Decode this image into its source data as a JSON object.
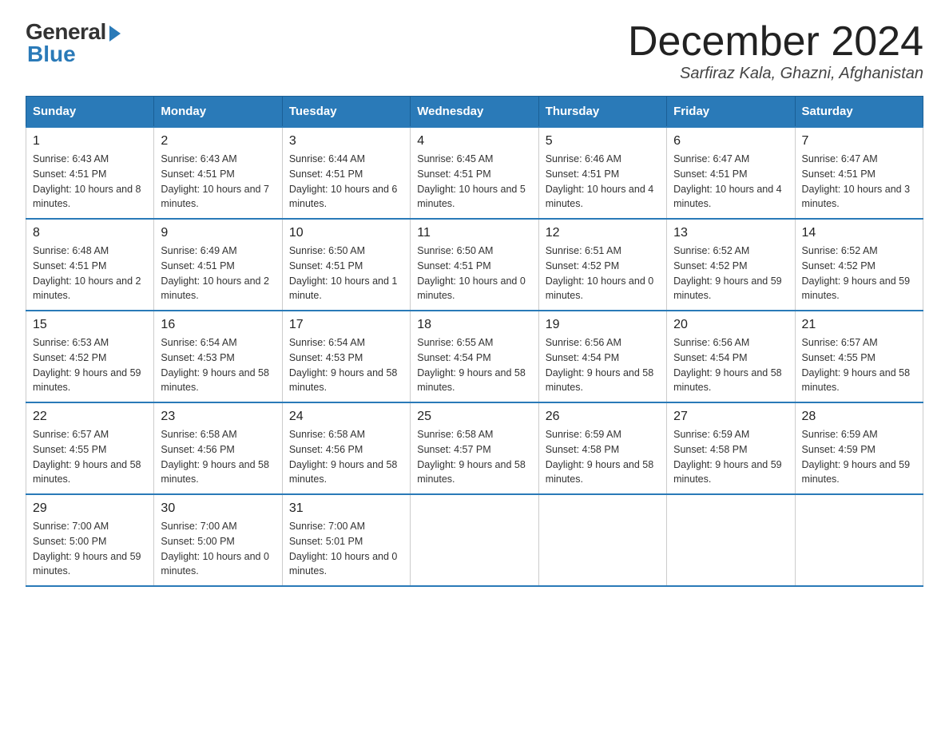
{
  "logo": {
    "general": "General",
    "blue": "Blue"
  },
  "header": {
    "month": "December 2024",
    "location": "Sarfiraz Kala, Ghazni, Afghanistan"
  },
  "weekdays": [
    "Sunday",
    "Monday",
    "Tuesday",
    "Wednesday",
    "Thursday",
    "Friday",
    "Saturday"
  ],
  "weeks": [
    [
      {
        "day": "1",
        "sunrise": "6:43 AM",
        "sunset": "4:51 PM",
        "daylight": "10 hours and 8 minutes."
      },
      {
        "day": "2",
        "sunrise": "6:43 AM",
        "sunset": "4:51 PM",
        "daylight": "10 hours and 7 minutes."
      },
      {
        "day": "3",
        "sunrise": "6:44 AM",
        "sunset": "4:51 PM",
        "daylight": "10 hours and 6 minutes."
      },
      {
        "day": "4",
        "sunrise": "6:45 AM",
        "sunset": "4:51 PM",
        "daylight": "10 hours and 5 minutes."
      },
      {
        "day": "5",
        "sunrise": "6:46 AM",
        "sunset": "4:51 PM",
        "daylight": "10 hours and 4 minutes."
      },
      {
        "day": "6",
        "sunrise": "6:47 AM",
        "sunset": "4:51 PM",
        "daylight": "10 hours and 4 minutes."
      },
      {
        "day": "7",
        "sunrise": "6:47 AM",
        "sunset": "4:51 PM",
        "daylight": "10 hours and 3 minutes."
      }
    ],
    [
      {
        "day": "8",
        "sunrise": "6:48 AM",
        "sunset": "4:51 PM",
        "daylight": "10 hours and 2 minutes."
      },
      {
        "day": "9",
        "sunrise": "6:49 AM",
        "sunset": "4:51 PM",
        "daylight": "10 hours and 2 minutes."
      },
      {
        "day": "10",
        "sunrise": "6:50 AM",
        "sunset": "4:51 PM",
        "daylight": "10 hours and 1 minute."
      },
      {
        "day": "11",
        "sunrise": "6:50 AM",
        "sunset": "4:51 PM",
        "daylight": "10 hours and 0 minutes."
      },
      {
        "day": "12",
        "sunrise": "6:51 AM",
        "sunset": "4:52 PM",
        "daylight": "10 hours and 0 minutes."
      },
      {
        "day": "13",
        "sunrise": "6:52 AM",
        "sunset": "4:52 PM",
        "daylight": "9 hours and 59 minutes."
      },
      {
        "day": "14",
        "sunrise": "6:52 AM",
        "sunset": "4:52 PM",
        "daylight": "9 hours and 59 minutes."
      }
    ],
    [
      {
        "day": "15",
        "sunrise": "6:53 AM",
        "sunset": "4:52 PM",
        "daylight": "9 hours and 59 minutes."
      },
      {
        "day": "16",
        "sunrise": "6:54 AM",
        "sunset": "4:53 PM",
        "daylight": "9 hours and 58 minutes."
      },
      {
        "day": "17",
        "sunrise": "6:54 AM",
        "sunset": "4:53 PM",
        "daylight": "9 hours and 58 minutes."
      },
      {
        "day": "18",
        "sunrise": "6:55 AM",
        "sunset": "4:54 PM",
        "daylight": "9 hours and 58 minutes."
      },
      {
        "day": "19",
        "sunrise": "6:56 AM",
        "sunset": "4:54 PM",
        "daylight": "9 hours and 58 minutes."
      },
      {
        "day": "20",
        "sunrise": "6:56 AM",
        "sunset": "4:54 PM",
        "daylight": "9 hours and 58 minutes."
      },
      {
        "day": "21",
        "sunrise": "6:57 AM",
        "sunset": "4:55 PM",
        "daylight": "9 hours and 58 minutes."
      }
    ],
    [
      {
        "day": "22",
        "sunrise": "6:57 AM",
        "sunset": "4:55 PM",
        "daylight": "9 hours and 58 minutes."
      },
      {
        "day": "23",
        "sunrise": "6:58 AM",
        "sunset": "4:56 PM",
        "daylight": "9 hours and 58 minutes."
      },
      {
        "day": "24",
        "sunrise": "6:58 AM",
        "sunset": "4:56 PM",
        "daylight": "9 hours and 58 minutes."
      },
      {
        "day": "25",
        "sunrise": "6:58 AM",
        "sunset": "4:57 PM",
        "daylight": "9 hours and 58 minutes."
      },
      {
        "day": "26",
        "sunrise": "6:59 AM",
        "sunset": "4:58 PM",
        "daylight": "9 hours and 58 minutes."
      },
      {
        "day": "27",
        "sunrise": "6:59 AM",
        "sunset": "4:58 PM",
        "daylight": "9 hours and 59 minutes."
      },
      {
        "day": "28",
        "sunrise": "6:59 AM",
        "sunset": "4:59 PM",
        "daylight": "9 hours and 59 minutes."
      }
    ],
    [
      {
        "day": "29",
        "sunrise": "7:00 AM",
        "sunset": "5:00 PM",
        "daylight": "9 hours and 59 minutes."
      },
      {
        "day": "30",
        "sunrise": "7:00 AM",
        "sunset": "5:00 PM",
        "daylight": "10 hours and 0 minutes."
      },
      {
        "day": "31",
        "sunrise": "7:00 AM",
        "sunset": "5:01 PM",
        "daylight": "10 hours and 0 minutes."
      },
      null,
      null,
      null,
      null
    ]
  ],
  "labels": {
    "sunrise": "Sunrise:",
    "sunset": "Sunset:",
    "daylight": "Daylight:"
  }
}
